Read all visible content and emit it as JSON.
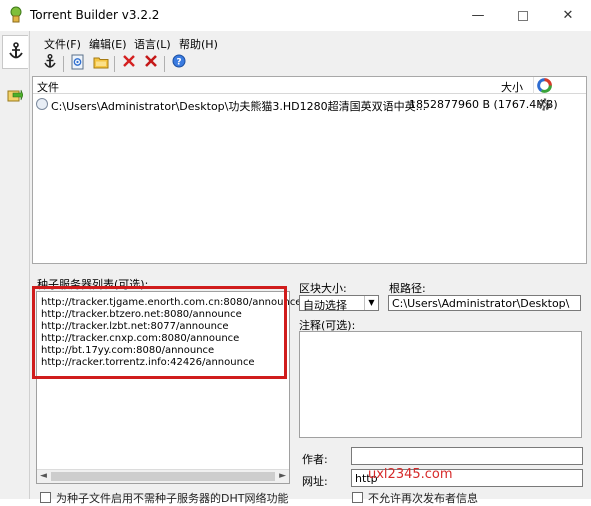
{
  "window": {
    "title": "Torrent Builder v3.2.2",
    "controls": {
      "minimize": "—",
      "close": "✕"
    }
  },
  "menu": [
    "文件(F)",
    "编辑(E)",
    "语言(L)",
    "帮助(H)"
  ],
  "toolbar": {
    "items": [
      "anchor-icon",
      "add-file-icon",
      "add-folder-icon",
      "remove-icon",
      "remove-all-icon",
      "help-icon"
    ]
  },
  "file_list": {
    "col_file": "文件",
    "col_size": "大小",
    "rows": [
      {
        "path": "C:\\Users\\Administrator\\Desktop\\功夫熊猫3.HD1280超清国英双语中英...",
        "size": "1852877960 B (1767.4MB)"
      }
    ]
  },
  "trackers": {
    "label": "种子服务器列表(可选):",
    "lines": [
      "http://tracker.tjgame.enorth.com.cn:8080/announce",
      "http://tracker.btzero.net:8080/announce",
      "http://tracker.lzbt.net:8077/announce",
      "http://tracker.cnxp.com:8080/announce",
      "http://bt.17yy.com:8080/announce",
      "http://racker.torrentz.info:42426/announce"
    ],
    "scroll_left": "◄",
    "scroll_right": "►"
  },
  "block_size": {
    "label": "区块大小:",
    "value": "自动选择",
    "caret": "▼"
  },
  "root_path": {
    "label": "根路径:",
    "value": "C:\\Users\\Administrator\\Desktop\\"
  },
  "comment": {
    "label": "注释(可选):",
    "value": ""
  },
  "author": {
    "label": "作者:",
    "value": ""
  },
  "url": {
    "label": "网址:",
    "value": "http"
  },
  "watermark": "uxl2345.com",
  "bottom": {
    "left_check_label": "为种子文件启用不需种子服务器的DHT网络功能",
    "right_check_label": "不允许再次发布者信息"
  },
  "colors": {
    "highlight_frame": "#d01c1c",
    "watermark": "#d62a2a",
    "window_bg": "#f0f0f0"
  }
}
